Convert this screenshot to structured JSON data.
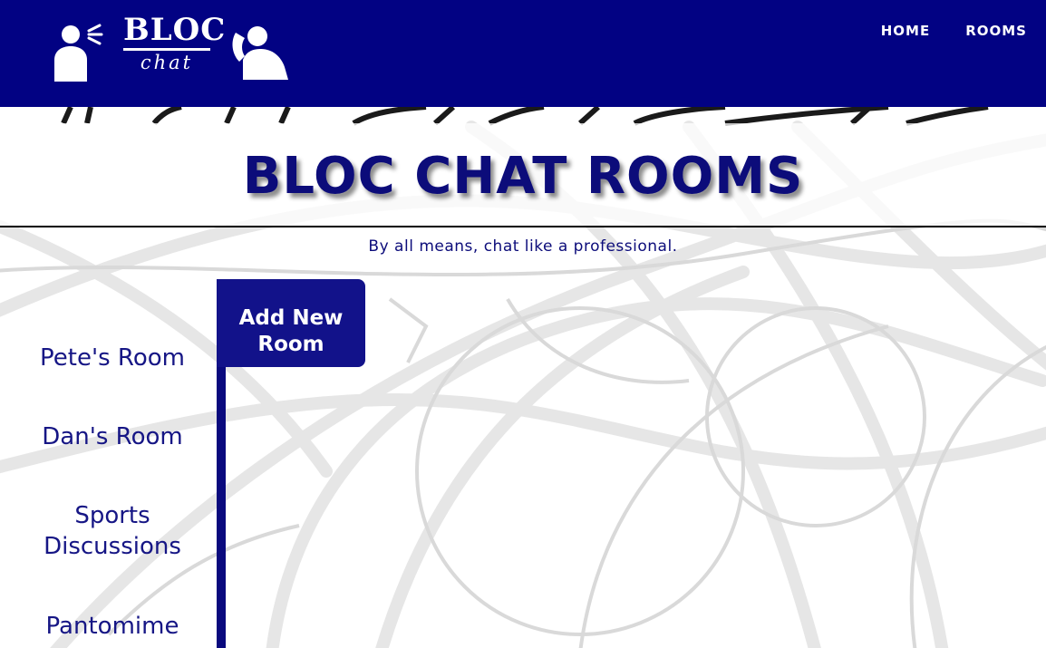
{
  "brand": {
    "logo_line1": "BLOC",
    "logo_line2": "chat"
  },
  "nav": {
    "home_label": "HOME",
    "rooms_label": "ROOMS"
  },
  "hero": {
    "title": "BLOC CHAT ROOMS",
    "tagline": "By all means, chat like a professional."
  },
  "actions": {
    "add_room_label": "Add New Room"
  },
  "rooms": [
    {
      "name": "Pete's Room"
    },
    {
      "name": "Dan's Room"
    },
    {
      "name": "Sports Discussions"
    },
    {
      "name": "Pantomime"
    }
  ],
  "colors": {
    "header_bg": "#020283",
    "title_text": "#0c0c7a",
    "accent": "#12128a"
  },
  "icons": {
    "logo_left": "person-shouting-icon",
    "logo_right": "person-listening-icon"
  }
}
